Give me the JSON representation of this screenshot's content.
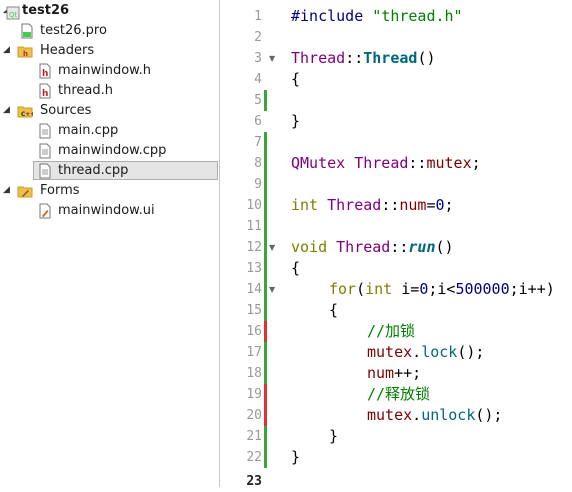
{
  "tree": {
    "project": "test26",
    "items": [
      {
        "label": "test26.pro",
        "icon": "pro-file-icon"
      },
      {
        "label": "Headers",
        "icon": "folder-headers-icon"
      },
      {
        "label": "mainwindow.h",
        "icon": "header-file-icon"
      },
      {
        "label": "thread.h",
        "icon": "header-file-icon"
      },
      {
        "label": "Sources",
        "icon": "folder-sources-icon"
      },
      {
        "label": "main.cpp",
        "icon": "source-file-icon"
      },
      {
        "label": "mainwindow.cpp",
        "icon": "source-file-icon"
      },
      {
        "label": "thread.cpp",
        "icon": "source-file-icon"
      },
      {
        "label": "Forms",
        "icon": "folder-forms-icon"
      },
      {
        "label": "mainwindow.ui",
        "icon": "form-file-icon"
      }
    ],
    "selected": "thread.cpp"
  },
  "editor": {
    "line_numbers": [
      "1",
      "2",
      "3",
      "4",
      "5",
      "6",
      "7",
      "8",
      "9",
      "10",
      "11",
      "12",
      "13",
      "14",
      "15",
      "16",
      "17",
      "18",
      "19",
      "20",
      "21",
      "22",
      "23"
    ],
    "current_line": "23",
    "colors": {
      "added_marker": "#3aa63a",
      "modified_marker": "#e03030",
      "keyword": "#808000",
      "type": "#800080",
      "comment": "#008000"
    },
    "tokens": {
      "l1_a": "#include",
      "l1_b": "\"thread.h\"",
      "l3_a": "Thread",
      "l3_b": "::",
      "l3_c": "Thread",
      "l3_d": "()",
      "l4": "{",
      "l6": "}",
      "l8_a": "QMutex",
      "l8_b": "Thread",
      "l8_c": "::",
      "l8_d": "mutex",
      "l8_e": ";",
      "l10_a": "int",
      "l10_b": "Thread",
      "l10_c": "::",
      "l10_d": "num",
      "l10_e": "=",
      "l10_f": "0",
      "l10_g": ";",
      "l12_a": "void",
      "l12_b": "Thread",
      "l12_c": "::",
      "l12_d": "run",
      "l12_e": "()",
      "l13": "{",
      "l14_a": "for",
      "l14_b": "(",
      "l14_c": "int",
      "l14_d": "i=",
      "l14_e": "0",
      "l14_f": ";i<",
      "l14_g": "500000",
      "l14_h": ";i++)",
      "l15": "{",
      "l16": "//加锁",
      "l17_a": "mutex",
      "l17_b": ".",
      "l17_c": "lock",
      "l17_d": "();",
      "l18_a": "num",
      "l18_b": "++;",
      "l19": "//释放锁",
      "l20_a": "mutex",
      "l20_b": ".",
      "l20_c": "unlock",
      "l20_d": "();",
      "l21": "}",
      "l22": "}"
    }
  }
}
